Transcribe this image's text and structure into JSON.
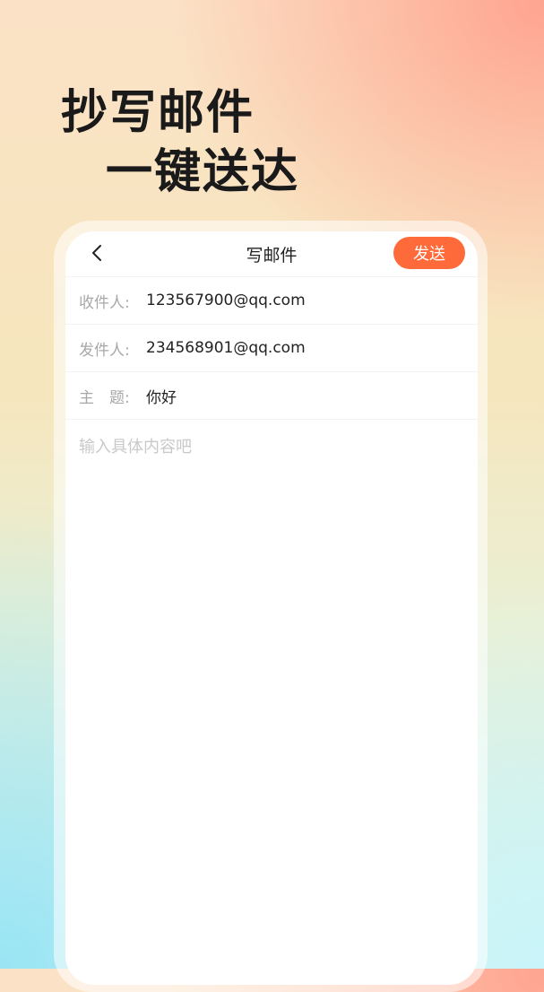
{
  "headline": {
    "line1": "抄写邮件",
    "line2": "一键送达"
  },
  "compose": {
    "title": "写邮件",
    "send_label": "发送",
    "to": {
      "label": "收件人:",
      "value": "123567900@qq.com"
    },
    "from": {
      "label": "发件人:",
      "value": "234568901@qq.com"
    },
    "subject": {
      "label": "主　题:",
      "value": "你好"
    },
    "body_placeholder": "输入具体内容吧"
  },
  "colors": {
    "accent": "#ff6a3a"
  }
}
